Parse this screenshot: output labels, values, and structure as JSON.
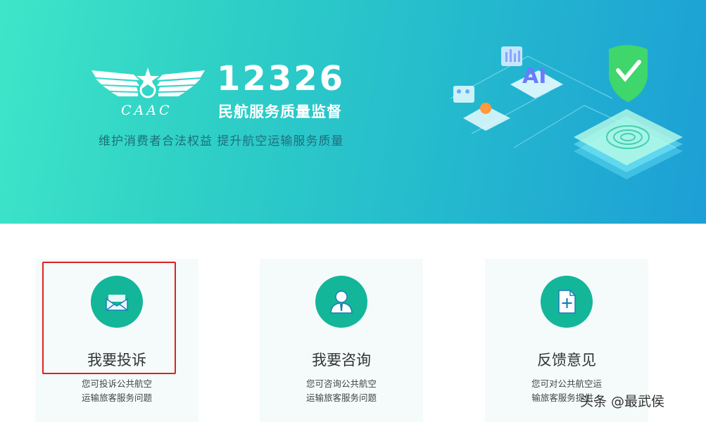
{
  "banner": {
    "logo_text": "CAAC",
    "hotline": "12326",
    "subtitle": "民航服务质量监督",
    "slogan": "维护消费者合法权益  提升航空运输服务质量",
    "illustration_label": "AI"
  },
  "cards": [
    {
      "icon": "envelope-icon",
      "title": "我要投诉",
      "desc_line1": "您可投诉公共航空",
      "desc_line2": "运输旅客服务问题"
    },
    {
      "icon": "person-icon",
      "title": "我要咨询",
      "desc_line1": "您可咨询公共航空",
      "desc_line2": "运输旅客服务问题"
    },
    {
      "icon": "document-add-icon",
      "title": "反馈意见",
      "desc_line1": "您可对公共航空运",
      "desc_line2": "输旅客服务提供..."
    }
  ],
  "watermark": "头条 @最武侯",
  "colors": {
    "accent": "#14b69a",
    "highlight": "#e02020",
    "banner_start": "#3ee6c8",
    "banner_end": "#1d9fd6"
  }
}
